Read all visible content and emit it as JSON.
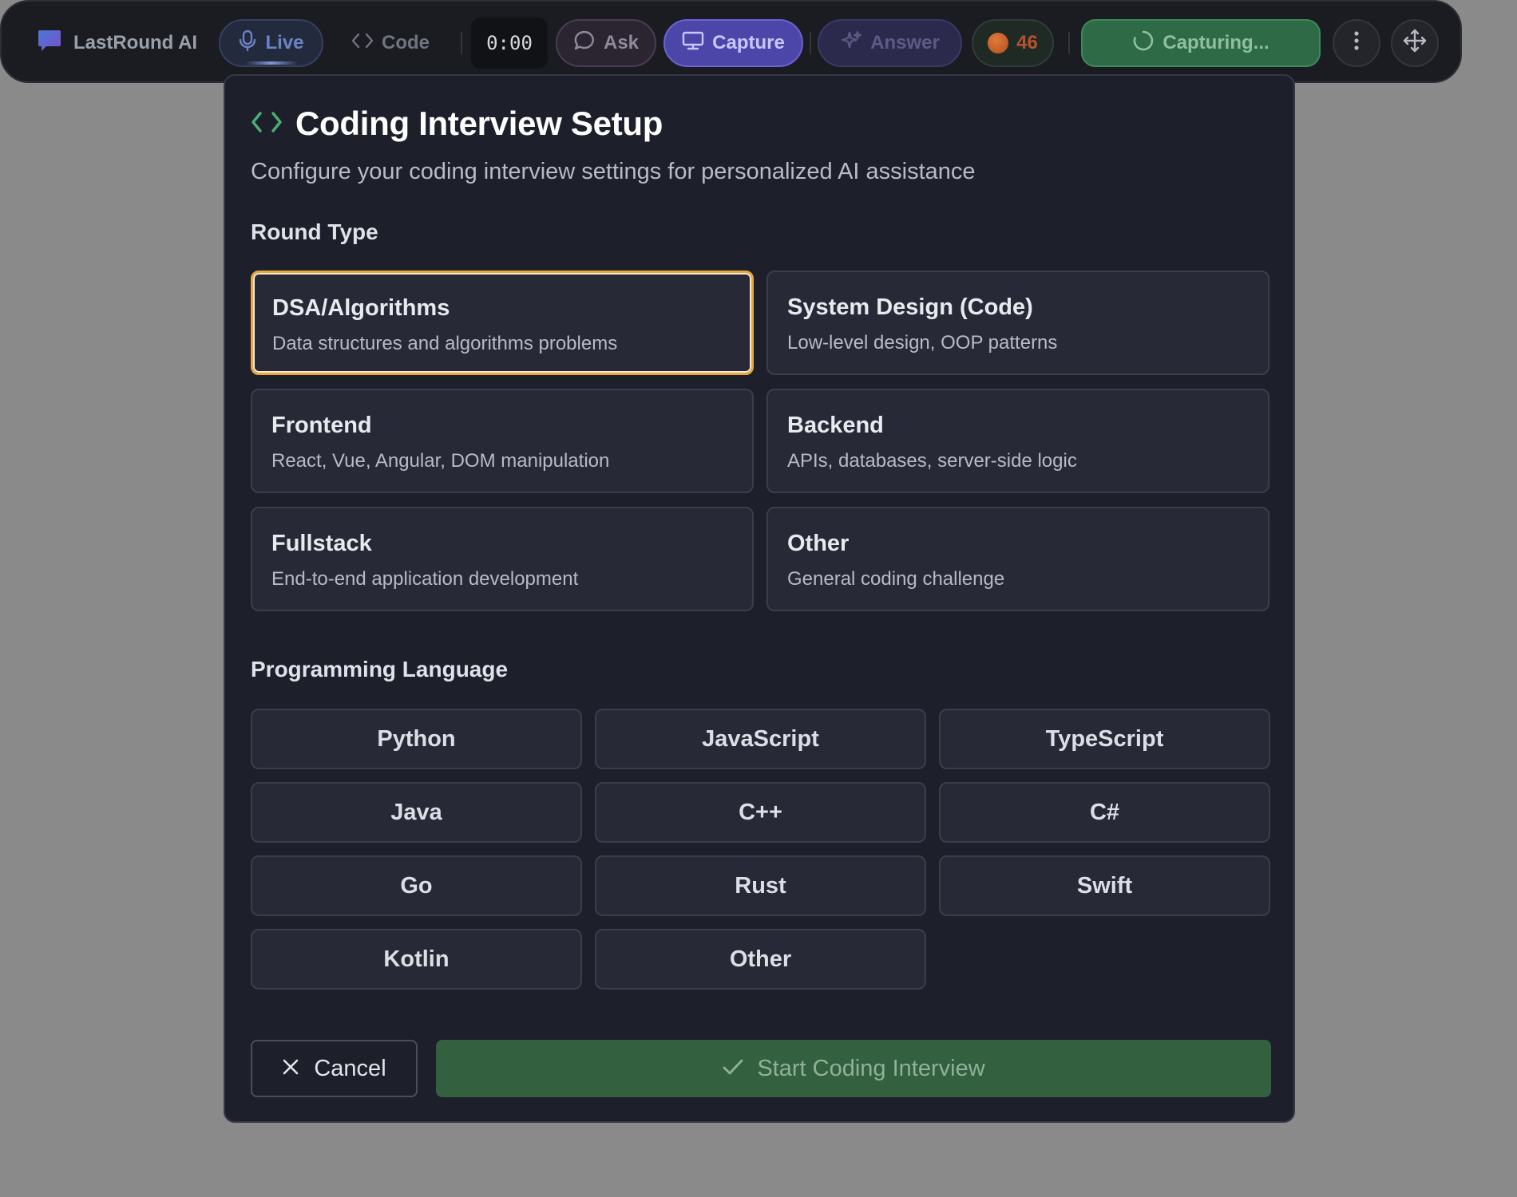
{
  "toolbar": {
    "brand": "LastRound AI",
    "live_label": "Live",
    "code_label": "Code",
    "timer": "0:00",
    "ask_label": "Ask",
    "capture_label": "Capture",
    "answer_label": "Answer",
    "credits": "46",
    "capturing_label": "Capturing..."
  },
  "dialog": {
    "title": "Coding Interview Setup",
    "subtitle": "Configure your coding interview settings for personalized AI assistance",
    "round_type_heading": "Round Type",
    "round_types": [
      {
        "title": "DSA/Algorithms",
        "desc": "Data structures and algorithms problems",
        "selected": true
      },
      {
        "title": "System Design (Code)",
        "desc": "Low-level design, OOP patterns",
        "selected": false
      },
      {
        "title": "Frontend",
        "desc": "React, Vue, Angular, DOM manipulation",
        "selected": false
      },
      {
        "title": "Backend",
        "desc": "APIs, databases, server-side logic",
        "selected": false
      },
      {
        "title": "Fullstack",
        "desc": "End-to-end application development",
        "selected": false
      },
      {
        "title": "Other",
        "desc": "General coding challenge",
        "selected": false
      }
    ],
    "language_heading": "Programming Language",
    "languages": [
      "Python",
      "JavaScript",
      "TypeScript",
      "Java",
      "C++",
      "C#",
      "Go",
      "Rust",
      "Swift",
      "Kotlin",
      "Other"
    ],
    "cancel_label": "Cancel",
    "start_label": "Start Coding Interview"
  },
  "colors": {
    "accent_selected": "#e7a93c",
    "start_button": "#33603f",
    "capture_button": "#4c46a8",
    "code_icon": "#4caf72"
  },
  "icons": {
    "brand": "chat-bubble-icon",
    "live": "microphone-icon",
    "code": "code-brackets-icon",
    "ask": "message-icon",
    "capture": "monitor-icon",
    "answer": "sparkle-icon",
    "credits": "coin-icon",
    "capturing": "spinner-icon",
    "more": "more-vertical-icon",
    "move": "move-icon",
    "cancel": "close-icon",
    "start": "check-icon"
  }
}
